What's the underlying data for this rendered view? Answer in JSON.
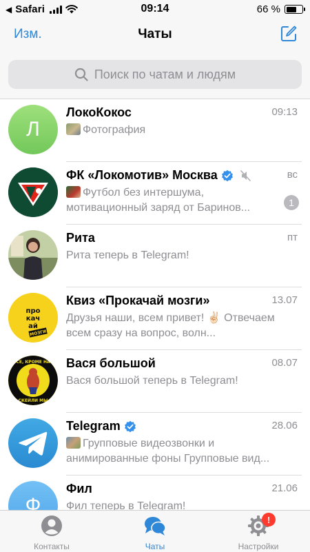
{
  "status_bar": {
    "back_glyph": "◀",
    "app": "Safari",
    "time": "09:14",
    "battery_text": "66 %",
    "battery_level": 0.66
  },
  "nav": {
    "edit_label": "Изм.",
    "title": "Чаты",
    "compose_icon": "compose-icon"
  },
  "search": {
    "placeholder": "Поиск по чатам и людям"
  },
  "chats": [
    {
      "name": "ЛокоКокос",
      "time": "09:13",
      "preview": "Фотография",
      "avatar_letter": "Л"
    },
    {
      "name": "ФК «Локомотив» Москва",
      "time": "вс",
      "preview": "Футбол без интершума, мотивационный заряд от Баринов...",
      "unread": "1"
    },
    {
      "name": "Рита",
      "time": "пт",
      "preview": "Рита теперь в Telegram!"
    },
    {
      "name": "Квиз «Прокачай мозги»",
      "time": "13.07",
      "preview": "Друзья наши, всем привет! ✌🏻 Отвечаем всем сразу на вопрос, волн...",
      "avatar_text": "прокачай мозги"
    },
    {
      "name": "Вася большой",
      "time": "08.07",
      "preview": "Вася большой теперь в Telegram!",
      "avatar_text_top": "ВСЕ, КРОМЕ НАС",
      "avatar_text_bottom": "СКЕЙЛИ МЫ"
    },
    {
      "name": "Telegram",
      "time": "28.06",
      "preview": "Групповые видеозвонки и анимированные фоны Групповые вид..."
    },
    {
      "name": "Фил",
      "time": "21.06",
      "preview": "Фил теперь в Telegram!",
      "avatar_letter": "Ф"
    }
  ],
  "tabs": [
    {
      "label": "Контакты",
      "icon": "contacts-icon"
    },
    {
      "label": "Чаты",
      "icon": "chats-icon",
      "active": true
    },
    {
      "label": "Настройки",
      "icon": "settings-icon",
      "badge": "!"
    }
  ],
  "colors": {
    "accent": "#2f87d8",
    "verified": "#3390ec",
    "unread_badge": "#b9b9be",
    "alert_badge": "#ff3b30",
    "secondary_text": "#8e8e93"
  }
}
